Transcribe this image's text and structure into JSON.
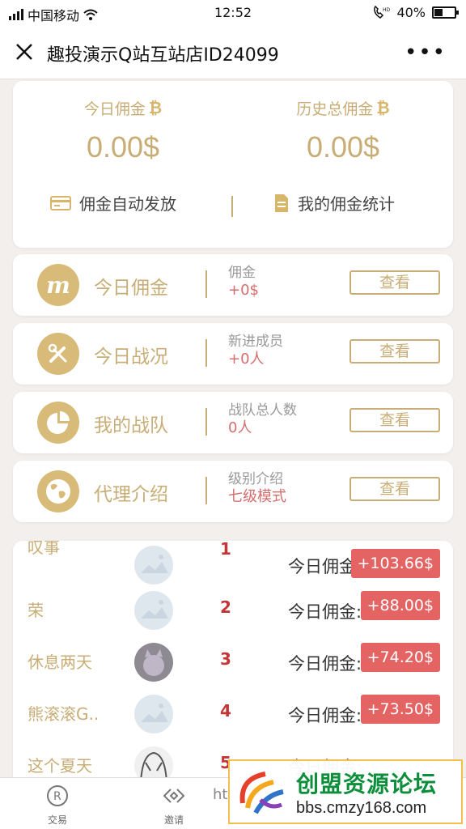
{
  "status": {
    "carrier": "中国移动",
    "time": "12:52",
    "battery": "40%",
    "battery_level": 0.4
  },
  "nav": {
    "title": "趣投演示Q站互站店ID24099"
  },
  "summary": {
    "today_label": "今日佣金",
    "today_value": "0.00$",
    "total_label": "历史总佣金",
    "total_value": "0.00$",
    "action_auto": "佣金自动发放",
    "action_stats": "我的佣金统计"
  },
  "rows": [
    {
      "name": "今日佣金",
      "desc_label": "佣金",
      "desc_value": "+0$",
      "button": "查看",
      "icon": "m-badge-icon"
    },
    {
      "name": "今日战况",
      "desc_label": "新进成员",
      "desc_value": "+0人",
      "button": "查看",
      "icon": "tools-icon"
    },
    {
      "name": "我的战队",
      "desc_label": "战队总人数",
      "desc_value": "0人",
      "button": "查看",
      "icon": "pie-chart-icon"
    },
    {
      "name": "代理介绍",
      "desc_label": "级别介绍",
      "desc_value": "七级模式",
      "button": "查看",
      "icon": "globe-icon"
    }
  ],
  "ranking": [
    {
      "name": "叹事",
      "rank": "1",
      "label": "今日佣金:",
      "amount": "+103.66$"
    },
    {
      "name": "荣",
      "rank": "2",
      "label": "今日佣金:",
      "amount": "+88.00$"
    },
    {
      "name": "休息两天",
      "rank": "3",
      "label": "今日佣金:",
      "amount": "+74.20$"
    },
    {
      "name": "熊滚滚G..",
      "rank": "4",
      "label": "今日佣金:",
      "amount": "+73.50$"
    },
    {
      "name": "这个夏天",
      "rank": "5",
      "label": "今日佣金:",
      "amount": ""
    }
  ],
  "tabs": {
    "trade": "交易",
    "invite": "邀请"
  },
  "ghost_text": "ht",
  "watermark": {
    "title": "创盟资源论坛",
    "url": "bbs.cmzy168.com"
  },
  "colors": {
    "gold": "#c8ae76",
    "red": "#e46464"
  }
}
